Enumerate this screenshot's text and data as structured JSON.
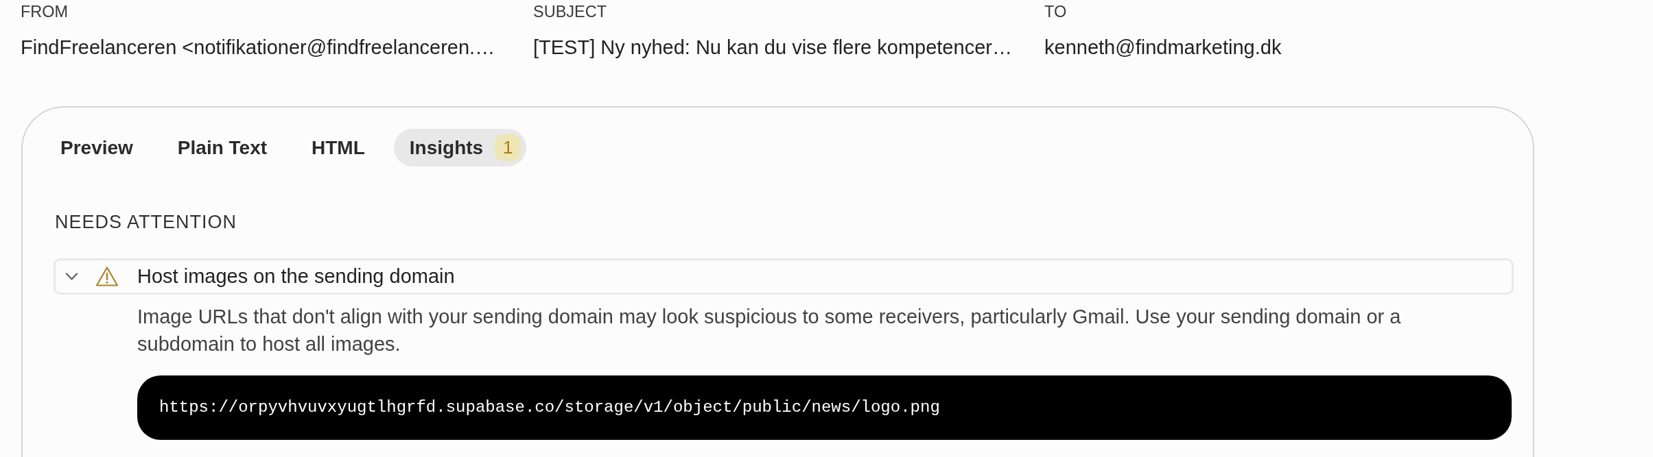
{
  "headers": [
    {
      "label": "FROM",
      "value": "FindFreelanceren <notifikationer@findfreelanceren.…"
    },
    {
      "label": "SUBJECT",
      "value": "[TEST] Ny nyhed: Nu kan du vise flere kompetencer…"
    },
    {
      "label": "TO",
      "value": "kenneth@findmarketing.dk"
    }
  ],
  "tabs": [
    {
      "label": "Preview",
      "selected": false
    },
    {
      "label": "Plain Text",
      "selected": false
    },
    {
      "label": "HTML",
      "selected": false
    },
    {
      "label": "Insights",
      "selected": true,
      "badge": "1"
    }
  ],
  "insights": {
    "heading": "NEEDS ATTENTION",
    "items": [
      {
        "kind": "warning",
        "title": "Host images on the sending domain",
        "expanded": true,
        "description": "Image URLs that don't align with your sending domain may look suspicious to some receivers, particularly Gmail. Use your sending domain or a subdomain to host all images.",
        "code": "https://orpyvhvuvxyugtlhgrfd.supabase.co/storage/v1/object/public/news/logo.png"
      }
    ]
  }
}
